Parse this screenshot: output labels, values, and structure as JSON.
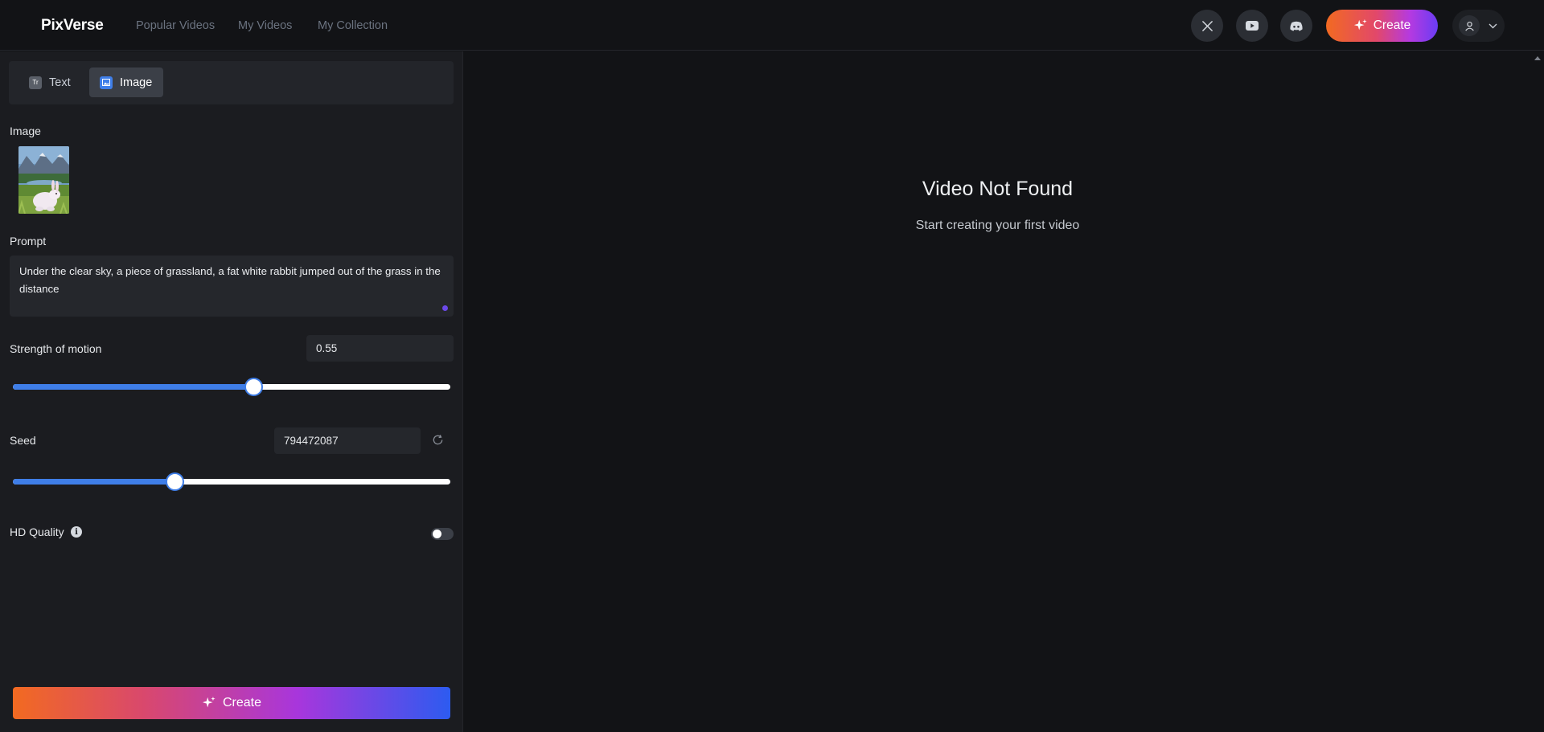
{
  "header": {
    "logo": "PixVerse",
    "nav": [
      {
        "label": "Popular Videos"
      },
      {
        "label": "My Videos"
      },
      {
        "label": "My Collection"
      }
    ],
    "social_icons": [
      "x-icon",
      "youtube-icon",
      "discord-icon"
    ],
    "create_label": "Create"
  },
  "left": {
    "tabs": [
      {
        "label": "Text",
        "icon": "text-icon",
        "active": false
      },
      {
        "label": "Image",
        "icon": "image-icon",
        "active": true
      }
    ],
    "image_label": "Image",
    "prompt_label": "Prompt",
    "prompt_text": "Under the clear sky, a piece of grassland, a fat white rabbit jumped out of the grass in the distance",
    "motion": {
      "label": "Strength of motion",
      "value": "0.55",
      "fraction": 0.55
    },
    "seed": {
      "label": "Seed",
      "value": "794472087",
      "fraction": 0.37
    },
    "hd": {
      "label": "HD Quality",
      "enabled": false
    },
    "create_label": "Create"
  },
  "main": {
    "empty_title": "Video Not Found",
    "empty_sub": "Start creating your first video"
  },
  "colors": {
    "accent_blue": "#3f7ee8",
    "brand_orange": "#f26a21",
    "brand_purple": "#6a3cf4",
    "background": "#121316",
    "panel": "#1b1c20"
  }
}
